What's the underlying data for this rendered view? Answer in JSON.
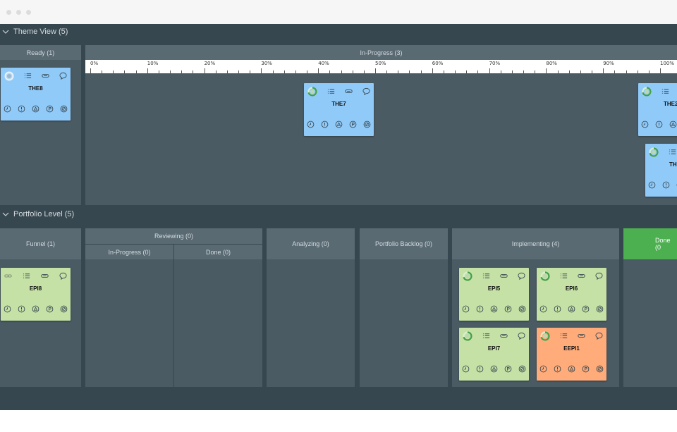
{
  "theme_view": {
    "header": "Theme View (5)",
    "columns": {
      "ready": "Ready (1)",
      "in_progress": "In-Progress (3)"
    },
    "ruler_labels": [
      "0%",
      "10%",
      "20%",
      "30%",
      "40%",
      "50%",
      "60%",
      "70%",
      "80%",
      "90%",
      "100%"
    ],
    "cards": {
      "the8": "THE8",
      "the7": "THE7",
      "the2": "THE2",
      "th": "TH"
    }
  },
  "portfolio_level": {
    "header": "Portfolio Level (5)",
    "columns": {
      "funnel": "Funnel (1)",
      "reviewing": "Reviewing (0)",
      "reviewing_in_progress": "In-Progress (0)",
      "reviewing_done": "Done (0)",
      "analyzing": "Analyzing (0)",
      "portfolio_backlog": "Portfolio Backlog (0)",
      "implementing": "Implementing (4)",
      "done": "Done (0"
    },
    "cards": {
      "epi8": "EPI8",
      "epi5": "EPI5",
      "epi6": "EPI6",
      "epi7": "EPI7",
      "eepi1": "EEPI1"
    }
  },
  "colors": {
    "app_background": "#37474f",
    "column_header": "#596a73",
    "column_body": "#4b5b63",
    "card_theme": "#90caf9",
    "card_epic": "#c5e1a5",
    "card_blocked": "#ffab7a",
    "done_header": "#4caf50"
  },
  "icons": {
    "card_top": [
      "progress-ring-icon",
      "checklist-icon",
      "attachment-icon",
      "comment-icon"
    ],
    "card_bottom": [
      "timer-icon",
      "exclamation-icon",
      "triangle-icon",
      "flag-p-icon",
      "blocked-icon"
    ]
  }
}
